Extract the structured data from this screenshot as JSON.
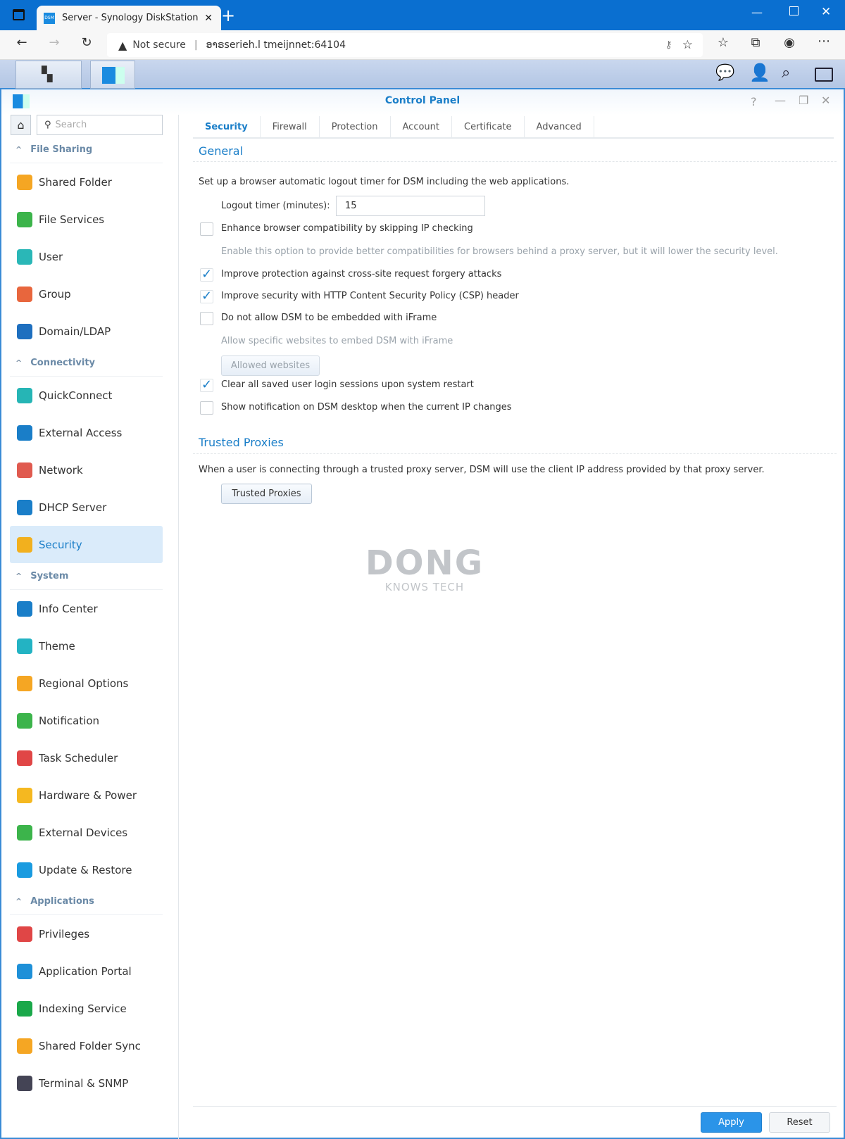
{
  "browser": {
    "tab_title": "Server - Synology DiskStation",
    "tab_favicon": "DSM",
    "not_secure": "Not secure",
    "url": "ອາຣserieh.l tmeijnnet:64104"
  },
  "dsm": {
    "window_title": "Control Panel"
  },
  "sidebar": {
    "search_placeholder": "Search",
    "sections": [
      {
        "title": "File Sharing",
        "items": [
          "Shared Folder",
          "File Services",
          "User",
          "Group",
          "Domain/LDAP"
        ]
      },
      {
        "title": "Connectivity",
        "items": [
          "QuickConnect",
          "External Access",
          "Network",
          "DHCP Server",
          "Security"
        ]
      },
      {
        "title": "System",
        "items": [
          "Info Center",
          "Theme",
          "Regional Options",
          "Notification",
          "Task Scheduler",
          "Hardware & Power",
          "External Devices",
          "Update & Restore"
        ]
      },
      {
        "title": "Applications",
        "items": [
          "Privileges",
          "Application Portal",
          "Indexing Service",
          "Shared Folder Sync",
          "Terminal & SNMP"
        ]
      }
    ],
    "selected": "Security"
  },
  "tabs": [
    "Security",
    "Firewall",
    "Protection",
    "Account",
    "Certificate",
    "Advanced"
  ],
  "general": {
    "title": "General",
    "desc": "Set up a browser automatic logout timer for DSM including the web applications.",
    "logout_label": "Logout timer (minutes):",
    "logout_value": "15",
    "options": [
      {
        "label": "Enhance browser compatibility by skipping IP checking",
        "checked": false
      },
      {
        "label": "Improve protection against cross-site request forgery attacks",
        "checked": true
      },
      {
        "label": "Improve security with HTTP Content Security Policy (CSP) header",
        "checked": true
      },
      {
        "label": "Do not allow DSM to be embedded with iFrame",
        "checked": false
      },
      {
        "label": "Clear all saved user login sessions upon system restart",
        "checked": true
      },
      {
        "label": "Show notification on DSM desktop when the current IP changes",
        "checked": false
      }
    ],
    "enhance_hint": "Enable this option to provide better compatibilities for browsers behind a proxy server, but it will lower the security level.",
    "iframe_hint": "Allow specific websites to embed DSM with iFrame",
    "allowed_websites": "Allowed websites"
  },
  "proxies": {
    "title": "Trusted Proxies",
    "desc": "When a user is connecting through a trusted proxy server, DSM will use the client IP address provided by that proxy server.",
    "button": "Trusted Proxies"
  },
  "watermark": {
    "line1": "DONG",
    "line2": "KNOWS TECH"
  },
  "footer": {
    "apply": "Apply",
    "reset": "Reset"
  },
  "colors": {
    "accent": "#1a7ec8",
    "browser_chrome": "#0a6fd0",
    "apply": "#2b94e8"
  }
}
